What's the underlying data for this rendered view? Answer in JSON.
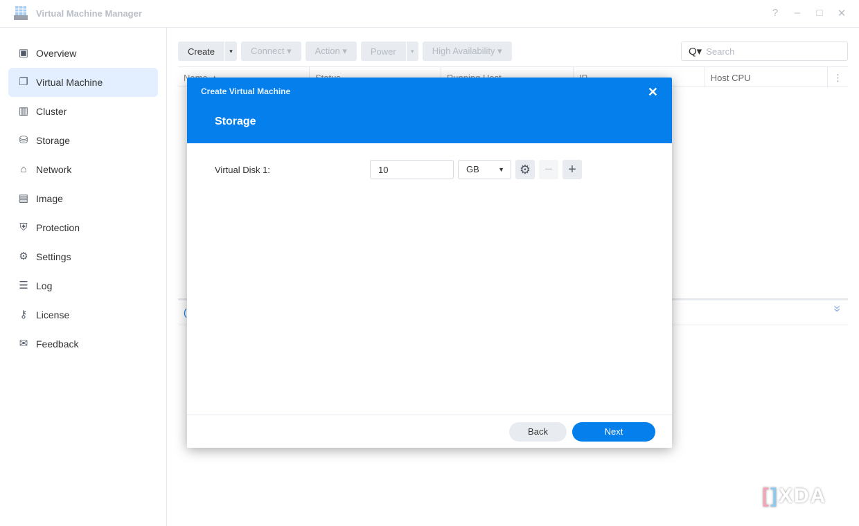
{
  "window": {
    "title": "Virtual Machine Manager",
    "controls": [
      "?",
      "–",
      "□",
      "✕"
    ]
  },
  "sidebar": {
    "items": [
      {
        "label": "Overview",
        "icon": "overview-icon",
        "glyph": "▣"
      },
      {
        "label": "Virtual Machine",
        "icon": "virtual-machine-icon",
        "glyph": "❐",
        "active": true
      },
      {
        "label": "Cluster",
        "icon": "cluster-icon",
        "glyph": "▥"
      },
      {
        "label": "Storage",
        "icon": "storage-icon",
        "glyph": "⛁"
      },
      {
        "label": "Network",
        "icon": "network-icon",
        "glyph": "⌂"
      },
      {
        "label": "Image",
        "icon": "image-icon",
        "glyph": "▤"
      },
      {
        "label": "Protection",
        "icon": "shield-icon",
        "glyph": "⛨"
      },
      {
        "label": "Settings",
        "icon": "gear-icon",
        "glyph": "⚙"
      },
      {
        "label": "Log",
        "icon": "list-icon",
        "glyph": "☰"
      },
      {
        "label": "License",
        "icon": "key-icon",
        "glyph": "⚷"
      },
      {
        "label": "Feedback",
        "icon": "mail-icon",
        "glyph": "✉"
      }
    ]
  },
  "toolbar": {
    "create": "Create",
    "connect": "Connect ▾",
    "action": "Action ▾",
    "power": "Power",
    "high_availability": "High Availability ▾",
    "dropdown": "▾"
  },
  "search": {
    "placeholder": "Search",
    "icon": "Q▾"
  },
  "grid": {
    "columns": [
      "Name ▲",
      "Status",
      "Running Host",
      "IP",
      "Host CPU"
    ],
    "menu": "⋮"
  },
  "detail": {
    "tab": "(",
    "collapse": "»"
  },
  "modal": {
    "header": "Create Virtual Machine",
    "step_title": "Storage",
    "close": "✕",
    "disk_label": "Virtual Disk 1:",
    "disk_size": "10",
    "disk_unit": "GB",
    "settings_glyph": "⚙",
    "remove_glyph": "−",
    "add_glyph": "+",
    "back": "Back",
    "next": "Next"
  },
  "watermark": {
    "left": "[",
    "right": "]",
    "text": "XDA"
  },
  "colors": {
    "accent": "#057feb",
    "active_nav": "#e3efff"
  }
}
